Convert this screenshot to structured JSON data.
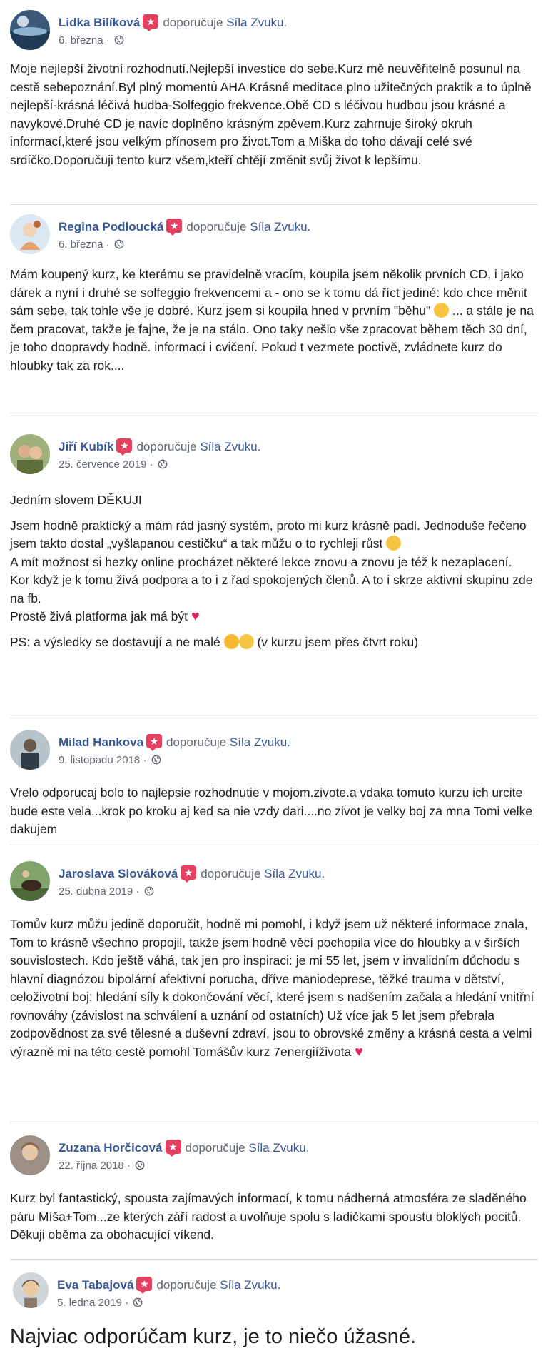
{
  "reviews": [
    {
      "author": "Lidka Bilíková",
      "verb": "doporučuje",
      "page": "Síla Zvuku.",
      "date": "6. března · ",
      "paragraphs": [
        "Moje nejlepší životní rozhodnutí.Nejlepší investice do sebe.Kurz mě neuvěřitelně posunul na cestě sebepoznání.Byl plný momentů AHA.Krásné meditace,plno užitečných praktik a to úplně nejlepší-krásná léčivá hudba-Solfeggio frekvence.Obě CD s léčivou hudbou jsou krásné a navykové.Druhé CD je navíc doplněno krásným zpěvem.Kurz zahrnuje široký okruh informací,které jsou velkým přínosem pro život.Tom a Miška do toho dávají celé své srdíčko.Doporučuji tento kurz všem,kteří chtějí změnit svůj život k lepšímu."
      ]
    },
    {
      "author": "Regina Podloucká",
      "verb": "doporučuje",
      "page": "Síla Zvuku.",
      "date": "6. března · ",
      "p1a": "Mám koupený kurz, ke kterému se pravidelně vracím, koupila jsem několik prvních CD, i jako dárek a nyní i druhé se solfeggio frekvencemi a - ono se k tomu dá říct jediné: kdo chce měnit sám sebe, tak tohle vše je dobré. Kurz jsem si koupila hned v prvním \"běhu\" ",
      "p1b": " ... a stále je na čem pracovat, takže je fajne, že je na stálo. Ono taky nešlo vše zpracovat během těch 30 dní, je toho doopravdy hodně. informací i cvičení. Pokud t vezmete poctivě, zvládnete kurz do hloubky tak za rok...."
    },
    {
      "author": "Jiří Kubík",
      "verb": "doporučuje",
      "page": "Síla Zvuku.",
      "date": "25. července 2019 · ",
      "p1": "Jedním slovem DĚKUJI",
      "p2a": "Jsem hodně praktický a mám rád jasný systém, proto mi kurz krásně padl. Jednoduše řečeno jsem takto dostal „vyšlapanou cestičku“ a tak můžu o to rychleji růst ",
      "p2b": "A mít možnost si hezky online procházet některé lekce znovu a znovu je též k nezaplacení.",
      "p2c": "Kor když je k tomu živá podpora a to i z řad spokojených členů. A to i skrze aktivní skupinu zde na fb.",
      "p2d": "Prostě živá platforma jak má být ",
      "p3a": "PS: a výsledky se dostavují a ne malé ",
      "p3b": " (v kurzu jsem přes čtvrt roku)"
    },
    {
      "author": "Milad Hankova",
      "verb": "doporučuje",
      "page": "Síla Zvuku.",
      "date": "9. listopadu 2018 · ",
      "p1": "Vrelo odporucaj bolo to najlepsie rozhodnutie v mojom.zivote.a vdaka tomuto kurzu ich urcite bude este vela...krok po kroku aj ked sa nie vzdy dari....no zivot je velky boj za mna Tomi velke dakujem"
    },
    {
      "author": "Jaroslava Slováková",
      "verb": "doporučuje",
      "page": "Síla Zvuku.",
      "date": "25. dubna 2019 · ",
      "p1": "Tomův kurz můžu jedině doporučit, hodně mi pomohl, i když jsem už některé informace znala, Tom to krásně všechno propojil, takže jsem hodně věcí pochopila více do hloubky a v širších souvislostech. Kdo ještě váhá, tak jen pro inspiraci: je mi 55 let, jsem v invalidním důchodu s hlavní diagnózou bipolární afektivní porucha, dříve maniodeprese, těžké trauma v dětství, celoživotní boj: hledání síly k dokončování věcí, které jsem s nadšením začala a hledání vnitřní rovnováhy (závislost na schválení a uznání od ostatních) Už více jak 5 let jsem přebrala zodpovědnost za své tělesné a duševní zdraví, jsou to obrovské změny a krásná cesta a velmi výrazně mi na této cestě pomohl Tomášův kurz 7energiíživota "
    },
    {
      "author": "Zuzana Horčicová",
      "verb": "doporučuje",
      "page": "Síla Zvuku.",
      "date": "22. října 2018 · ",
      "p1": "Kurz byl fantastický, spousta zajímavých informací, k tomu nádherná atmosféra ze sladěného páru Míša+Tom...ze kterých září radost a uvolňuje spolu s ladičkami spoustu bloklých pocitů. Děkuji oběma za obohacující víkend."
    },
    {
      "author": "Eva Tabajová",
      "verb": "doporučuje",
      "page": "Síla Zvuku.",
      "date": "5. ledna 2019 · ",
      "p1": "Najviac odporúčam kurz, je to niečo úžasné."
    }
  ],
  "colors": {
    "author": "#385898",
    "text": "#1c1e21",
    "meta": "#606770",
    "badge": "#e4405f",
    "divider": "#dadde1"
  }
}
